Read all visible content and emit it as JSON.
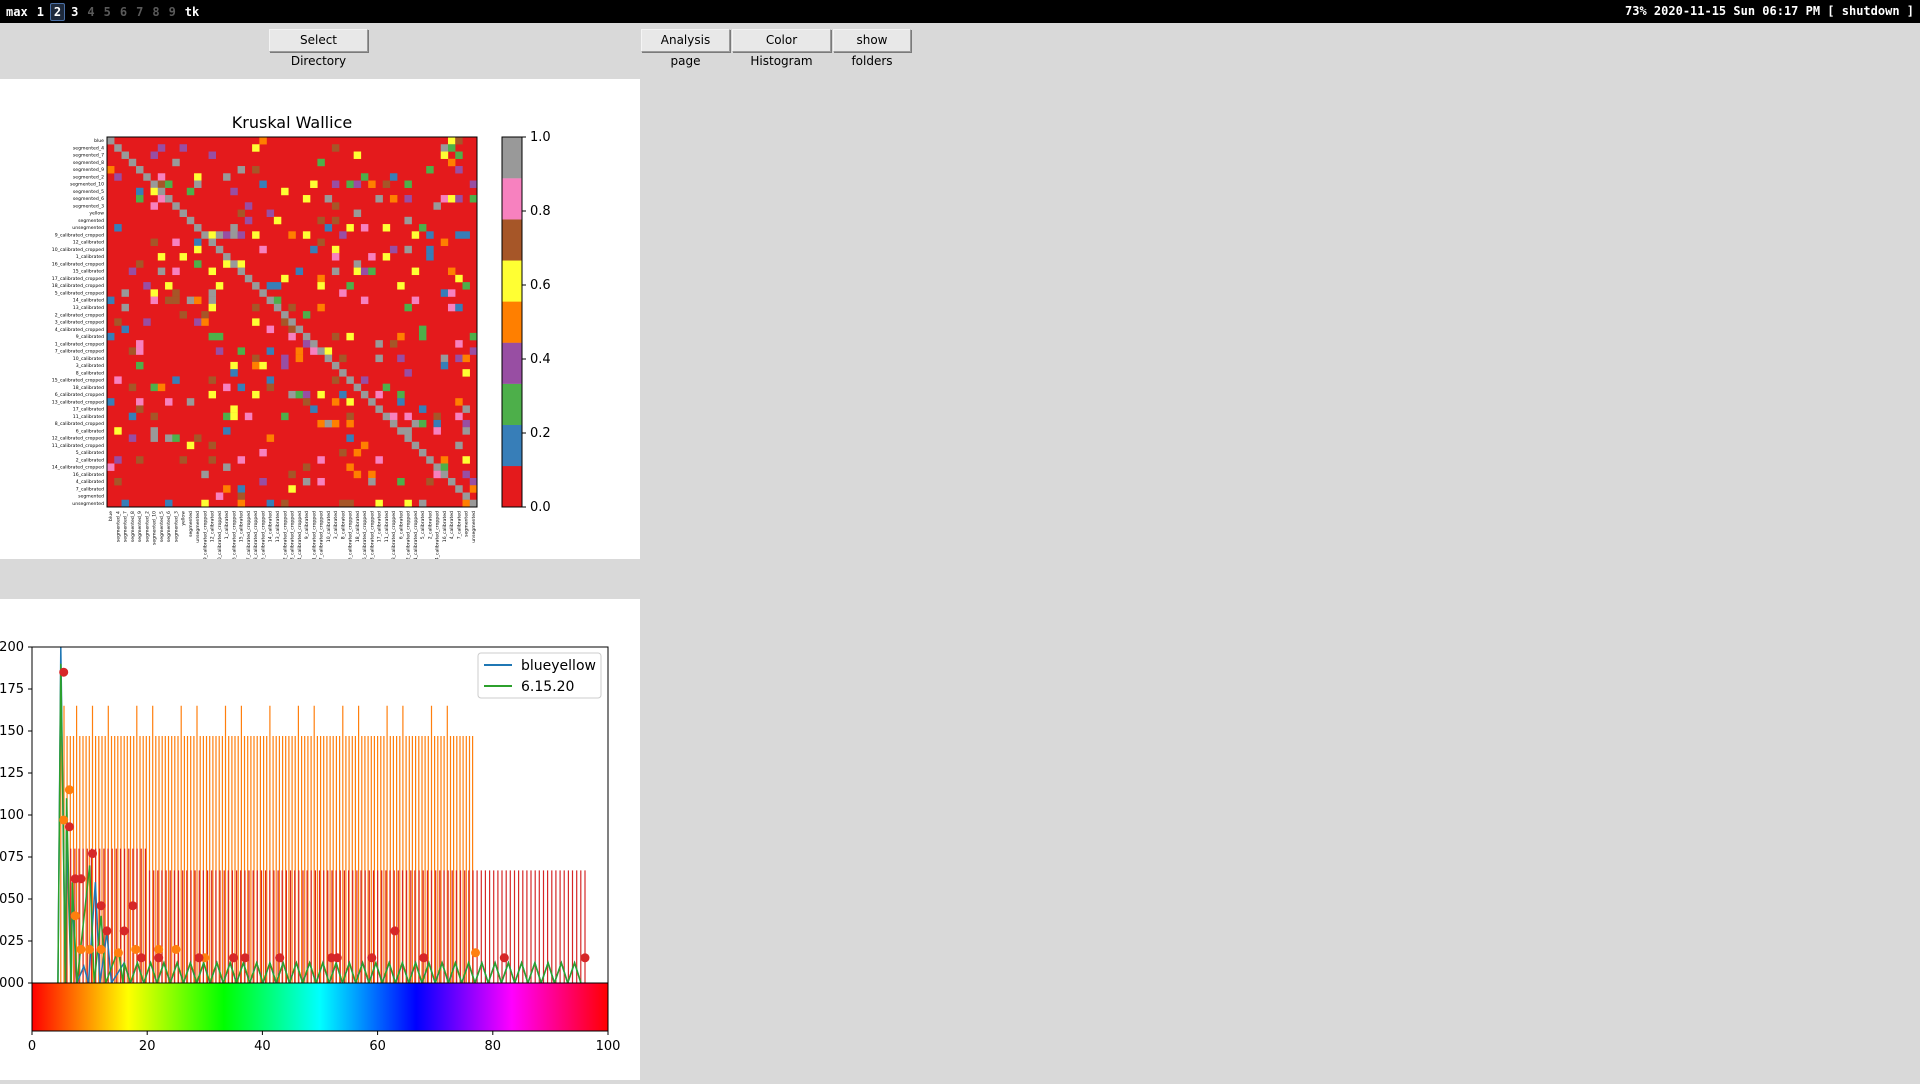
{
  "topbar": {
    "layout": "max",
    "workspaces": [
      {
        "label": "1",
        "state": "occupied"
      },
      {
        "label": "2",
        "state": "current"
      },
      {
        "label": "3",
        "state": "occupied"
      },
      {
        "label": "4",
        "state": "empty"
      },
      {
        "label": "5",
        "state": "empty"
      },
      {
        "label": "6",
        "state": "empty"
      },
      {
        "label": "7",
        "state": "empty"
      },
      {
        "label": "8",
        "state": "empty"
      },
      {
        "label": "9",
        "state": "empty"
      }
    ],
    "window_title": "tk",
    "status": "73% 2020-11-15 Sun 06:17 PM [ shutdown ]"
  },
  "buttons": {
    "select_directory": "Select Directory",
    "analysis_page": "Analysis page",
    "color_histogram": "Color Histogram",
    "show_folders": "show folders"
  },
  "chart_data": [
    {
      "type": "heatmap",
      "title": "Kruskal Wallice",
      "labels": [
        "blue",
        "segmented_4",
        "segmented_7",
        "segmented_8",
        "segmented_9",
        "segmented_2",
        "segmented_10",
        "segmented_5",
        "segmented_6",
        "segmented_3",
        "yellow",
        "segmented",
        "unsegmented",
        "9_calibrated_cropped",
        "12_calibrated",
        "10_calibrated_cropped",
        "1_calibrated",
        "16_calibrated_cropped",
        "15_calibrated",
        "17_calibrated_cropped",
        "18_calibrated_cropped",
        "5_calibrated_cropped",
        "14_calibrated",
        "13_calibrated",
        "2_calibrated_cropped",
        "3_calibrated_cropped",
        "4_calibrated_cropped",
        "9_calibrated",
        "1_calibrated_cropped",
        "7_calibrated_cropped",
        "10_calibrated",
        "3_calibrated",
        "8_calibrated",
        "15_calibrated_cropped",
        "18_calibrated",
        "6_calibrated_cropped",
        "13_calibrated_cropped",
        "17_calibrated",
        "11_calibrated",
        "8_calibrated_cropped",
        "6_calibrated",
        "12_calibrated_cropped",
        "11_calibrated_cropped",
        "5_calibrated",
        "2_calibrated",
        "14_calibrated_cropped",
        "16_calibrated",
        "4_calibrated",
        "7_calibrated",
        "segmented",
        "unsegmented"
      ],
      "colorbar": {
        "colors": [
          "#e41a1c",
          "#377eb8",
          "#4daf4a",
          "#984ea3",
          "#ff7f00",
          "#ffff33",
          "#a65628",
          "#f781bf",
          "#999999"
        ],
        "ticks": [
          "0.0",
          "0.2",
          "0.4",
          "0.6",
          "0.8",
          "1.0"
        ],
        "range": [
          0,
          1
        ]
      }
    },
    {
      "type": "line",
      "xlim": [
        0,
        100
      ],
      "ylim": [
        0,
        0.2
      ],
      "xticks": [
        "0",
        "20",
        "40",
        "60",
        "80",
        "100"
      ],
      "yticks": [
        "200",
        "175",
        "150",
        "125",
        "100",
        "075",
        "050",
        "025",
        "000"
      ],
      "legend_position": "top-right",
      "series": [
        {
          "name": "blueyellow",
          "color": "#1f77b4",
          "peaks": [
            [
              5,
              0.2
            ],
            [
              6,
              0.09
            ],
            [
              7,
              0.05
            ],
            [
              9,
              0.01
            ],
            [
              11,
              0.06
            ],
            [
              13,
              0.03
            ]
          ]
        },
        {
          "name": "6.15.20",
          "color": "#2ca02c",
          "peaks": [
            [
              5,
              0.19
            ],
            [
              6,
              0.11
            ],
            [
              7,
              0.06
            ],
            [
              10,
              0.07
            ],
            [
              12,
              0.04
            ],
            [
              15,
              0.02
            ]
          ]
        }
      ],
      "markers_orange": [
        [
          5.5,
          0.097
        ],
        [
          6.5,
          0.115
        ],
        [
          7.5,
          0.04
        ],
        [
          8.5,
          0.02
        ],
        [
          10,
          0.02
        ],
        [
          12,
          0.02
        ],
        [
          15,
          0.018
        ],
        [
          18,
          0.02
        ],
        [
          22,
          0.02
        ],
        [
          25,
          0.02
        ],
        [
          30,
          0.015
        ],
        [
          35,
          0.015
        ],
        [
          43,
          0.015
        ],
        [
          52,
          0.015
        ],
        [
          68,
          0.015
        ],
        [
          77,
          0.018
        ]
      ],
      "markers_red": [
        [
          5.5,
          0.185
        ],
        [
          6.5,
          0.093
        ],
        [
          7.5,
          0.062
        ],
        [
          8.5,
          0.062
        ],
        [
          10.5,
          0.077
        ],
        [
          12,
          0.046
        ],
        [
          13,
          0.031
        ],
        [
          16,
          0.031
        ],
        [
          17.5,
          0.046
        ],
        [
          19,
          0.015
        ],
        [
          22,
          0.015
        ],
        [
          29,
          0.015
        ],
        [
          35,
          0.015
        ],
        [
          37,
          0.015
        ],
        [
          43,
          0.015
        ],
        [
          52,
          0.015
        ],
        [
          53,
          0.015
        ],
        [
          59,
          0.015
        ],
        [
          63,
          0.031
        ],
        [
          68,
          0.015
        ],
        [
          82,
          0.015
        ],
        [
          96,
          0.015
        ]
      ]
    }
  ]
}
